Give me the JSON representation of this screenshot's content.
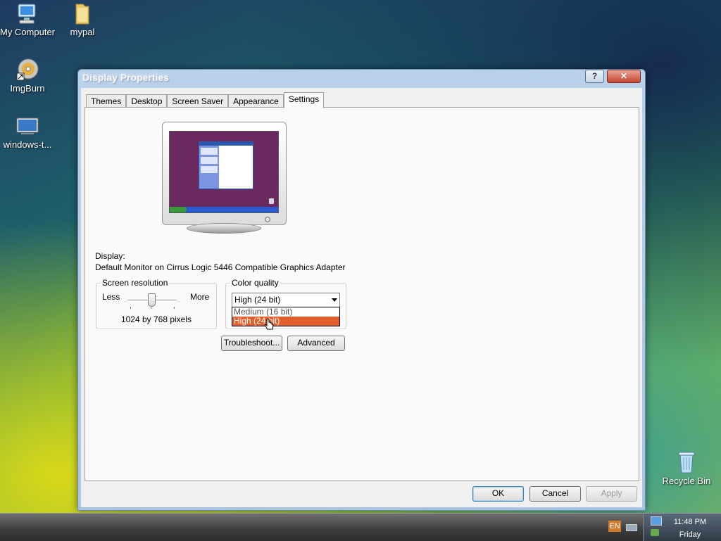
{
  "desktop": {
    "icons": [
      {
        "label": "My Computer"
      },
      {
        "label": "mypal"
      },
      {
        "label": "ImgBurn"
      },
      {
        "label": "windows-t..."
      },
      {
        "label": "Recycle Bin"
      }
    ]
  },
  "dialog": {
    "title": "Display Properties",
    "help_label": "?",
    "close_label": "✕",
    "tabs": [
      "Themes",
      "Desktop",
      "Screen Saver",
      "Appearance",
      "Settings"
    ],
    "active_tab": "Settings",
    "display_label": "Display:",
    "display_value": "Default Monitor on Cirrus Logic 5446 Compatible Graphics Adapter",
    "resolution": {
      "group_title": "Screen resolution",
      "less_label": "Less",
      "more_label": "More",
      "value_text": "1024 by 768 pixels"
    },
    "color_quality": {
      "group_title": "Color quality",
      "selected": "High (24 bit)",
      "options": [
        "Medium (16 bit)",
        "High (24 bit)"
      ],
      "highlighted": "High (24 bit)"
    },
    "buttons": {
      "troubleshoot": "Troubleshoot...",
      "advanced": "Advanced",
      "ok": "OK",
      "cancel": "Cancel",
      "apply": "Apply"
    }
  },
  "taskbar": {
    "language": "EN",
    "time": "11:48 PM",
    "day": "Friday"
  }
}
